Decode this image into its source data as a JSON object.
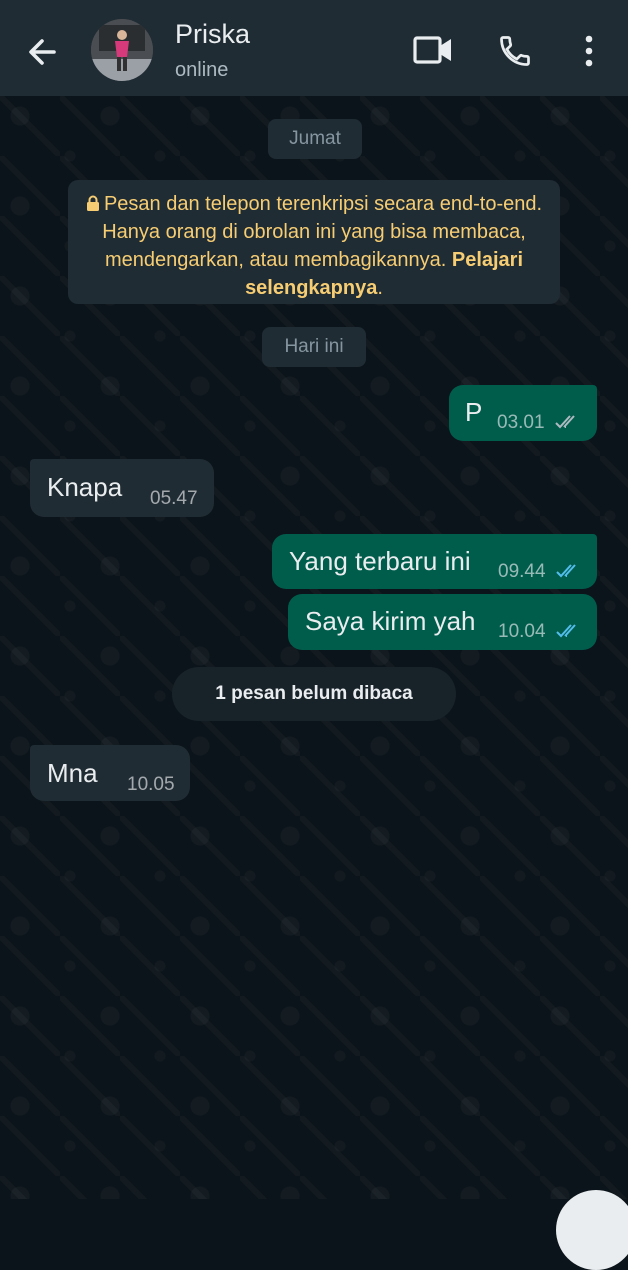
{
  "header": {
    "contact_name": "Priska",
    "status": "online"
  },
  "chat": {
    "date_chip_1": "Jumat",
    "encryption_notice": "Pesan dan telepon terenkripsi secara end-to-end. Hanya orang di obrolan ini yang bisa membaca, mendengarkan, atau membagikannya.",
    "encryption_link": "Pelajari selengkapnya",
    "date_chip_2": "Hari ini",
    "unread_banner": "1 pesan belum dibaca",
    "messages": [
      {
        "direction": "out",
        "text": "P",
        "time": "03.01",
        "status": "delivered"
      },
      {
        "direction": "in",
        "text": "Knapa",
        "time": "05.47"
      },
      {
        "direction": "out",
        "text": "Yang terbaru ini",
        "time": "09.44",
        "status": "read"
      },
      {
        "direction": "out",
        "text": "Saya kirim yah",
        "time": "10.04",
        "status": "read"
      },
      {
        "direction": "in",
        "text": "Mna",
        "time": "10.05"
      }
    ]
  },
  "colors": {
    "background": "#0b141a",
    "header": "#1f2c34",
    "bubble_in": "#202c33",
    "bubble_out": "#005c4b",
    "read_ticks": "#53bdeb",
    "delivered_ticks": "#aebac1",
    "encryption_text": "#f7cd73"
  },
  "icons": [
    "back-arrow-icon",
    "video-call-icon",
    "phone-call-icon",
    "more-vert-icon",
    "lock-icon",
    "double-check-icon"
  ]
}
